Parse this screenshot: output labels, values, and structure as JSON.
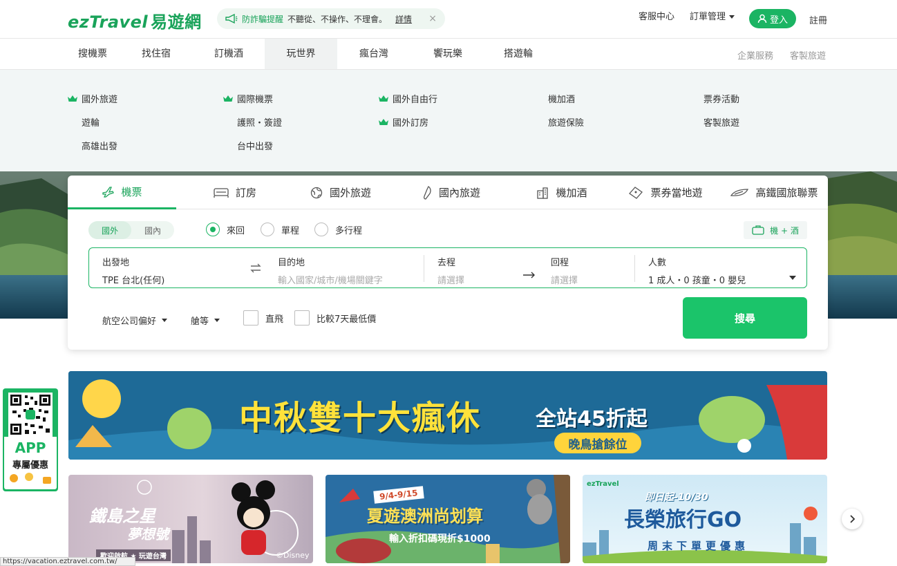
{
  "header": {
    "logo_en": "ezTravel",
    "logo_cn": "易遊網",
    "notice": {
      "title": "防詐騙提醒",
      "text": "不聽從、不操作、不理會。",
      "link": "詳情",
      "close": "×"
    },
    "links": {
      "service": "客服中心",
      "orders": "訂單管理",
      "login": "登入",
      "register": "註冊"
    }
  },
  "nav": {
    "items": [
      "搜機票",
      "找住宿",
      "訂機酒",
      "玩世界",
      "瘋台灣",
      "饗玩樂",
      "搭遊輪"
    ],
    "active": "玩世界",
    "right": [
      "企業服務",
      "客製旅遊"
    ]
  },
  "dropdown": {
    "col1": [
      "國外旅遊",
      "遊輪",
      "高雄出發"
    ],
    "col2": [
      "國際機票",
      "護照・簽證",
      "台中出發"
    ],
    "col3": [
      "國外自由行",
      "國外訂房"
    ],
    "col4": [
      "機加酒",
      "旅遊保險"
    ],
    "col5": [
      "票券活動",
      "客製旅遊"
    ]
  },
  "search": {
    "tabs": [
      "機票",
      "訂房",
      "國外旅遊",
      "國內旅遊",
      "機加酒",
      "票券當地遊",
      "高鐵國旅聯票"
    ],
    "active_tab": "機票",
    "scope": [
      "國外",
      "國內"
    ],
    "trip_types": [
      "來回",
      "單程",
      "多行程"
    ],
    "combo": "機 + 酒",
    "from": {
      "label": "出發地",
      "value": "TPE 台北(任何)"
    },
    "to": {
      "label": "目的地",
      "placeholder": "輸入國家/城市/機場關鍵字"
    },
    "depart": {
      "label": "去程",
      "placeholder": "請選擇"
    },
    "return": {
      "label": "回程",
      "placeholder": "請選擇"
    },
    "pax": {
      "label": "人數",
      "value": "1 成人・0 孩童・0 嬰兒"
    },
    "options": {
      "airline": "航空公司偏好",
      "cabin": "艙等",
      "direct": "直飛",
      "compare": "比較7天最低價"
    },
    "button": "搜尋"
  },
  "banner": {
    "title1": "中秋雙十大瘋休",
    "title2": "全站45折起",
    "tag": "晚鳥搶餘位"
  },
  "app": {
    "label": "APP",
    "sub": "專屬優惠"
  },
  "promos": [
    {
      "line1": "鐵島之星",
      "line2": "夢想號",
      "sub": "歡迎啟航 ★ 玩遊台灣",
      "credit": "©Disney"
    },
    {
      "date": "9/4-9/15",
      "line1": "夏遊澳洲尚划算",
      "sub": "輸入折扣碼現折$1000"
    },
    {
      "date": "即日起-10/30",
      "line1": "長榮旅行GO",
      "sub": "周末下單更優惠"
    }
  ],
  "statusbar": "https://vacation.eztravel.com.tw/"
}
